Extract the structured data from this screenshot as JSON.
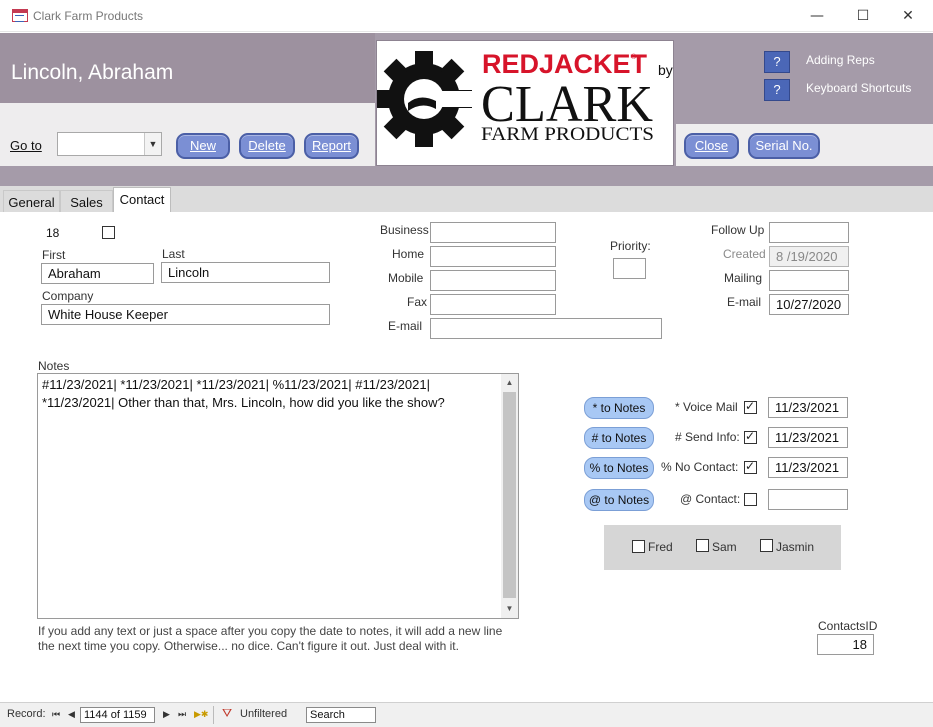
{
  "window": {
    "title": "Clark Farm Products",
    "minimize": "—",
    "maximize": "☐",
    "close": "✕"
  },
  "header": {
    "record_name": "Lincoln, Abraham",
    "goto_label": "Go to",
    "goto_value": "",
    "buttons": {
      "new": "New",
      "delete": "Delete",
      "report": "Report",
      "close": "Close",
      "serial": "Serial No."
    },
    "help": [
      {
        "icon": "?",
        "label": "Adding Reps"
      },
      {
        "icon": "?",
        "label": "Keyboard Shortcuts"
      }
    ],
    "logo": {
      "brand": "REDJACKET",
      "by": "by",
      "company": "CLARK",
      "subtitle": "FARM PRODUCTS",
      "registered": "®"
    }
  },
  "tabs": [
    {
      "label": "General"
    },
    {
      "label": "Sales"
    },
    {
      "label": "Contact",
      "active": true
    }
  ],
  "contact": {
    "id_number": "18",
    "first_label": "First",
    "first": "Abraham",
    "last_label": "Last",
    "last": "Lincoln",
    "company_label": "Company",
    "company": "White House Keeper",
    "phones": {
      "business_label": "Business",
      "business": "",
      "home_label": "Home",
      "home": "",
      "mobile_label": "Mobile",
      "mobile": "",
      "fax_label": "Fax",
      "fax": "",
      "email_label": "E-mail",
      "email": ""
    },
    "priority_label": "Priority:",
    "priority": "",
    "follow_up_label": "Follow Up",
    "follow_up": "",
    "created_label": "Created",
    "created": "8 /19/2020",
    "mailing_label": "Mailing",
    "mailing": "",
    "email2_label": "E-mail",
    "email2": "10/27/2020"
  },
  "notes": {
    "label": "Notes",
    "text": "#11/23/2021|  *11/23/2021|  *11/23/2021|  %11/23/2021|  #11/23/2021|  *11/23/2021| Other than that, Mrs. Lincoln, how did you like the show?",
    "hint": "If you add any text or just a space after you copy the date to notes, it will add a new line the next time you copy. Otherwise... no dice. Can't figure it out. Just deal with it."
  },
  "actions": [
    {
      "button": "* to Notes",
      "label": "* Voice Mail",
      "checked": true,
      "date": "11/23/2021"
    },
    {
      "button": "# to Notes",
      "label": "# Send Info:",
      "checked": true,
      "date": "11/23/2021"
    },
    {
      "button": "% to Notes",
      "label": "% No Contact:",
      "checked": true,
      "date": "11/23/2021"
    },
    {
      "button": "@ to Notes",
      "label": "@ Contact:",
      "checked": false,
      "date": ""
    }
  ],
  "people": [
    {
      "name": "Fred",
      "checked": false
    },
    {
      "name": "Sam",
      "checked": false
    },
    {
      "name": "Jasmin",
      "checked": false
    }
  ],
  "contacts_id": {
    "label": "ContactsID",
    "value": "18"
  },
  "statusbar": {
    "record_label": "Record:",
    "first": "⏮",
    "prev": "◀",
    "position": "1144 of 1159",
    "next": "▶",
    "last": "⏭",
    "new": "▶✱",
    "filter": "Unfiltered",
    "search_placeholder": "Search"
  }
}
